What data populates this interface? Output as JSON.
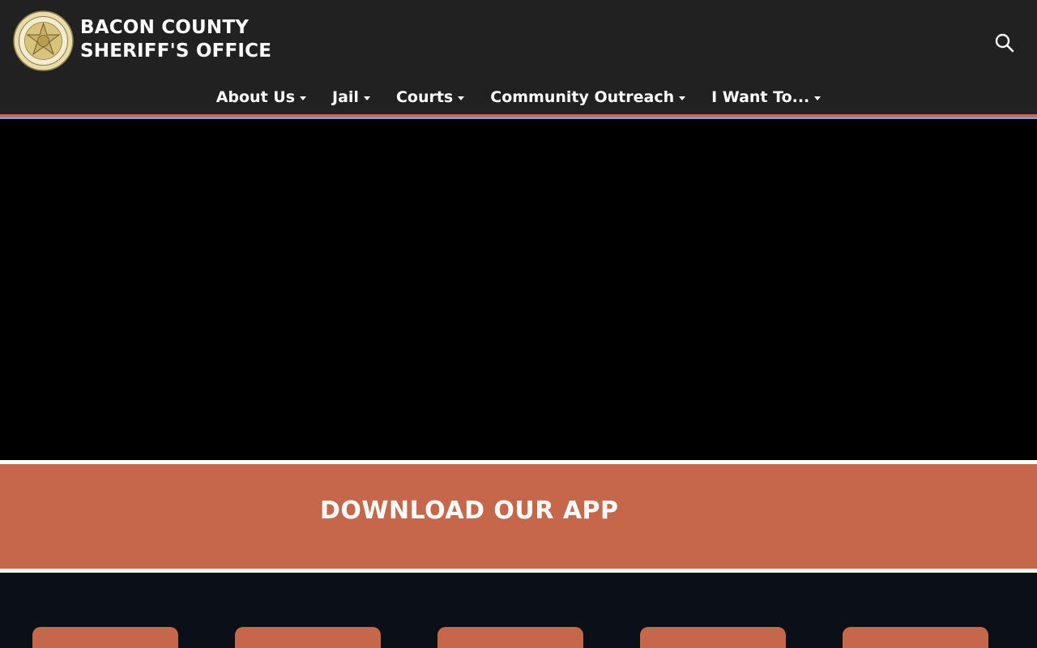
{
  "header": {
    "title_line1": "BACON COUNTY",
    "title_line2": "SHERIFF'S OFFICE",
    "logo": {
      "name": "sheriff-badge-logo",
      "ring_text_top": "BACON COUNTY",
      "ring_text_bottom": "SHERIFF'S OFFICE",
      "badge_text": "SHERIFF'S OFFICE"
    },
    "search_icon": "search-icon"
  },
  "nav": {
    "items": [
      {
        "label": "About Us",
        "has_dropdown": true
      },
      {
        "label": "Jail",
        "has_dropdown": true
      },
      {
        "label": "Courts",
        "has_dropdown": true
      },
      {
        "label": "Community Outreach",
        "has_dropdown": true
      },
      {
        "label": "I Want To...",
        "has_dropdown": true
      }
    ]
  },
  "banner": {
    "label": "DOWNLOAD OUR APP"
  },
  "quick_links": {
    "count_visible": 5
  },
  "colors": {
    "header_bg": "#212121",
    "accent_orange": "#c4674b",
    "accent_blue": "#7f9ac9",
    "hero_bg": "#000000",
    "dark_section_bg": "#0b1017",
    "text_white": "#ffffff"
  }
}
